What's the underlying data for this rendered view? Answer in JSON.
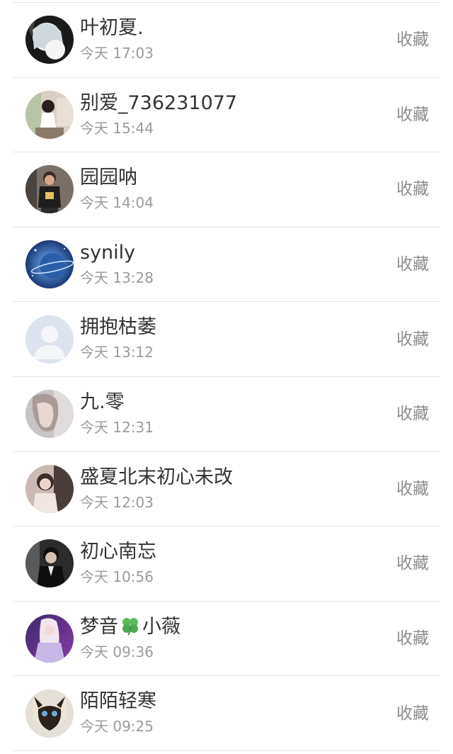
{
  "friends": [
    {
      "name": "叶初夏.",
      "time": "今天 17:03",
      "action": "收藏"
    },
    {
      "name": "别爱_736231077",
      "time": "今天 15:44",
      "action": "收藏"
    },
    {
      "name": "园园呐",
      "time": "今天 14:04",
      "action": "收藏"
    },
    {
      "name": "synily",
      "time": "今天 13:28",
      "action": "收藏"
    },
    {
      "name": "拥抱枯萎",
      "time": "今天 13:12",
      "action": "收藏"
    },
    {
      "name": "九.零",
      "time": "今天 12:31",
      "action": "收藏"
    },
    {
      "name": "盛夏北末初心未改",
      "time": "今天 12:03",
      "action": "收藏"
    },
    {
      "name": "初心南忘",
      "time": "今天 10:56",
      "action": "收藏"
    },
    {
      "name_prefix": "梦音",
      "name_suffix": "小薇",
      "name_icon": "four-leaf-clover-icon",
      "time": "今天 09:36",
      "action": "收藏"
    },
    {
      "name": "陌陌轻寒",
      "time": "今天 09:25",
      "action": "收藏"
    }
  ],
  "colors": {
    "name_text": "#333333",
    "time_text": "#9b9b9b",
    "action_text": "#8c8c8c",
    "divider": "#e6e6e6",
    "clover": "#5cb85c"
  }
}
